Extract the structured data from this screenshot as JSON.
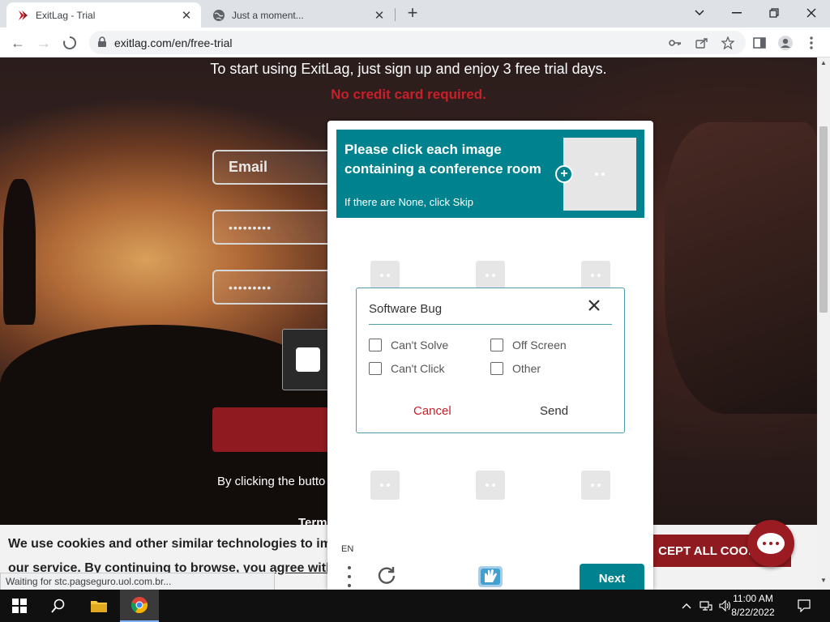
{
  "browser": {
    "tabs": [
      {
        "label": "ExitLag - Trial",
        "icon": "exitlag-logo-icon",
        "active": true
      },
      {
        "label": "Just a moment...",
        "icon": "globe-icon",
        "active": false
      }
    ],
    "new_tab_symbol": "+",
    "window_controls": {
      "dropdown": "⌄",
      "minimize": "—",
      "restore": "❐",
      "close": "✕"
    },
    "url": "exitlag.com/en/free-trial",
    "nav": {
      "back": "←",
      "forward": "→"
    },
    "toolbar_icons": [
      "key-icon",
      "share-icon",
      "star-icon",
      "side-panel-icon",
      "profile-icon",
      "menu-icon"
    ]
  },
  "page": {
    "intro": "To start using ExitLag, just sign up and enjoy 3 free trial days.",
    "no_card": "No credit card required.",
    "email_placeholder": "Email",
    "password_mask": "•••••••••",
    "confirm_mask": "•••••••••",
    "by_clicking": "By clicking the butto",
    "terms": "Term",
    "cookie_line1": "We use cookies and other similar technologies to impr",
    "cookie_line2": "our service. By continuing to browse, you agree with o",
    "accept_label": "CEPT ALL COOKIES",
    "status": "Waiting for stc.pagseguro.uol.com.br..."
  },
  "captcha": {
    "prompt_title": "Please click each image containing a conference room",
    "prompt_sub": "If there are None, click Skip",
    "language": "EN",
    "next_label": "Next",
    "report": {
      "title": "Software Bug",
      "options": [
        "Can't Solve",
        "Off Screen",
        "Can't Click",
        "Other"
      ],
      "cancel": "Cancel",
      "send": "Send"
    }
  },
  "taskbar": {
    "time": "11:00 AM",
    "date": "8/22/2022"
  },
  "colors": {
    "accent_teal": "#00838f",
    "brand_red": "#8f1a1f",
    "no_card_red": "#c8202a"
  }
}
